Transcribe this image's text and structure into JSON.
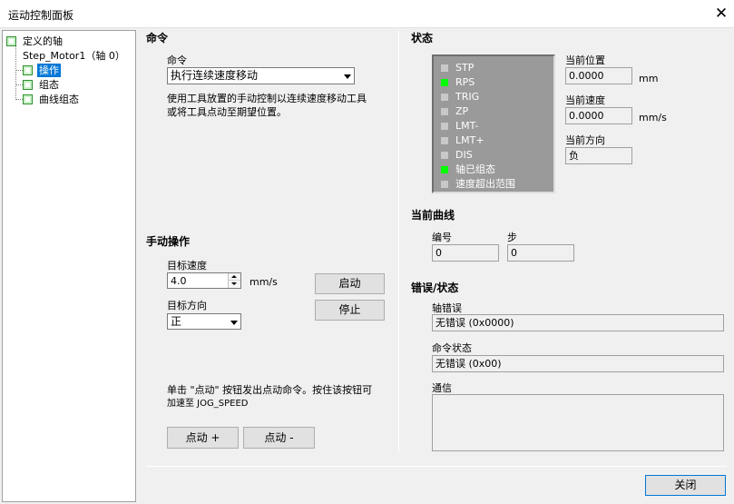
{
  "window": {
    "title": "运动控制面板",
    "close_glyph": "✕"
  },
  "tree": {
    "root": "定义的轴",
    "motor": "Step_Motor1（轴 0）",
    "children": [
      "操作",
      "组态",
      "曲线组态"
    ],
    "selected_index": 0
  },
  "command": {
    "section_title": "命令",
    "label": "命令",
    "selected": "执行连续速度移动",
    "description_line1": "使用工具放置的手动控制以连续速度移动工具",
    "description_line2": "或将工具点动至期望位置。"
  },
  "manual": {
    "section_title": "手动操作",
    "speed_label": "目标速度",
    "speed_value": "4.0",
    "speed_unit": "mm/s",
    "direction_label": "目标方向",
    "direction_value": "正",
    "start_button": "启动",
    "stop_button": "停止",
    "hint_line1": "单击 \"点动\" 按钮发出点动命令。按住该按钮可",
    "hint_line2": "加速至 JOG_SPEED",
    "jog_plus_button": "点动 +",
    "jog_minus_button": "点动 -"
  },
  "status": {
    "section_title": "状态",
    "leds": [
      {
        "label": "STP",
        "on": false
      },
      {
        "label": "RPS",
        "on": true
      },
      {
        "label": "TRIG",
        "on": false
      },
      {
        "label": "ZP",
        "on": false
      },
      {
        "label": "LMT-",
        "on": false
      },
      {
        "label": "LMT+",
        "on": false
      },
      {
        "label": "DIS",
        "on": false
      },
      {
        "label": "轴已组态",
        "on": true
      },
      {
        "label": "速度超出范围",
        "on": false
      }
    ],
    "position_label": "当前位置",
    "position_value": "0.0000",
    "position_unit": "mm",
    "velocity_label": "当前速度",
    "velocity_value": "0.0000",
    "velocity_unit": "mm/s",
    "direction_label": "当前方向",
    "direction_value": "负",
    "led_on_color": "#00ff00",
    "led_off_color": "#c8c8c8"
  },
  "curve": {
    "section_title": "当前曲线",
    "number_label": "编号",
    "number_value": "0",
    "step_label": "步",
    "step_value": "0"
  },
  "errors": {
    "section_title": "错误/状态",
    "axis_error_label": "轴错误",
    "axis_error_value": "无错误 (0x0000)",
    "command_status_label": "命令状态",
    "command_status_value": "无错误 (0x00)",
    "comm_label": "通信",
    "comm_value": ""
  },
  "footer": {
    "close_button": "关闭"
  }
}
